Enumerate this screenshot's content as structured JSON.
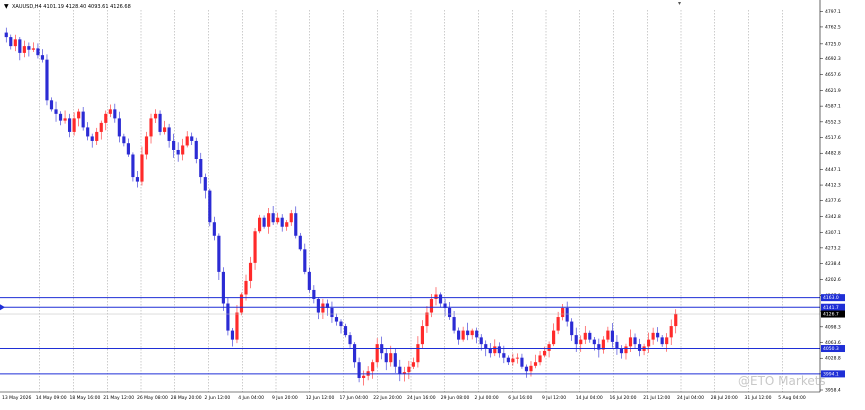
{
  "header": {
    "symbol_info": "XAUUSD,H4  4101.19 4128.40 4093.61 4126.68"
  },
  "watermark": "@ETO Markets",
  "colors": {
    "bull": "#ff2a2a",
    "bear": "#2b2bd4",
    "level_line": "#1f2fd6",
    "grid": "#9a9a9a",
    "label_bg": "#1f2fd6"
  },
  "y_axis": {
    "ticks": [
      "4797.1",
      "4762.5",
      "4725.0",
      "4692.3",
      "4657.6",
      "4621.9",
      "4587.1",
      "4552.3",
      "4517.6",
      "4482.8",
      "4447.1",
      "4412.3",
      "4377.6",
      "4342.8",
      "4307.1",
      "4273.2",
      "4238.4",
      "4202.6",
      "4167.9",
      "4133.1",
      "4098.3",
      "4063.6",
      "4028.8",
      "3994.1",
      "3958.4"
    ],
    "price_min": 3954,
    "price_max": 4800
  },
  "price_labels": [
    {
      "text": "4163.0",
      "price": 4163.0
    },
    {
      "text": "4141.7",
      "price": 4141.7
    },
    {
      "text": "4126.7",
      "price": 4126.7
    },
    {
      "text": "4050.3",
      "price": 4050.3
    },
    {
      "text": "3994.1",
      "price": 3994.1
    }
  ],
  "horizontal_levels": [
    4163.0,
    4141.7,
    4050.3,
    3994.1
  ],
  "x_axis": {
    "labels": [
      "13 May 2026",
      "14 May 09:00",
      "18 May 16:00",
      "21 May 12:00",
      "26 May 08:00",
      "28 May 20:00",
      "2 Jun 12:00",
      "4 Jun 04:00",
      "9 Jun 20:00",
      "12 Jun 12:00",
      "17 Jun 04:00",
      "22 Jun 20:00",
      "24 Jun 16:00",
      "29 Jun 08:00",
      "2 Jul 00:00",
      "6 Jul 16:00",
      "9 Jul 12:00",
      "14 Jul 04:00",
      "16 Jul 20:00",
      "21 Jul 12:00",
      "24 Jul 04:00",
      "28 Jul 20:00",
      "31 Jul 12:00",
      "5 Aug 04:00"
    ]
  },
  "chart_data": {
    "type": "candlestick",
    "title": "XAUUSD,H4",
    "ylim": [
      3954,
      4800
    ],
    "close_path": [
      4740,
      4720,
      4735,
      4705,
      4720,
      4712,
      4715,
      4700,
      4690,
      4600,
      4580,
      4570,
      4555,
      4560,
      4530,
      4560,
      4575,
      4540,
      4520,
      4510,
      4530,
      4550,
      4570,
      4580,
      4560,
      4520,
      4505,
      4480,
      4430,
      4420,
      4480,
      4520,
      4560,
      4570,
      4530,
      4540,
      4510,
      4490,
      4480,
      4500,
      4520,
      4510,
      4470,
      4430,
      4400,
      4330,
      4300,
      4220,
      4150,
      4090,
      4070,
      4130,
      4170,
      4200,
      4240,
      4310,
      4340,
      4320,
      4350,
      4330,
      4340,
      4320,
      4330,
      4350,
      4300,
      4270,
      4220,
      4180,
      4160,
      4130,
      4150,
      4140,
      4120,
      4110,
      4100,
      4080,
      4060,
      4020,
      3985,
      3990,
      4000,
      4020,
      4060,
      4040,
      4020,
      4040,
      4010,
      3995,
      3998,
      4010,
      4020,
      4060,
      4100,
      4130,
      4160,
      4170,
      4150,
      4140,
      4120,
      4090,
      4070,
      4090,
      4080,
      4090,
      4075,
      4060,
      4050,
      4040,
      4055,
      4040,
      4030,
      4020,
      4028,
      4030,
      4010,
      4000,
      4012,
      4020,
      4035,
      4045,
      4060,
      4090,
      4120,
      4140,
      4110,
      4080,
      4060,
      4070,
      4085,
      4070,
      4060,
      4048,
      4070,
      4090,
      4065,
      4050,
      4040,
      4055,
      4075,
      4060,
      4045,
      4055,
      4070,
      4085,
      4075,
      4060,
      4075,
      4100,
      4127
    ]
  }
}
